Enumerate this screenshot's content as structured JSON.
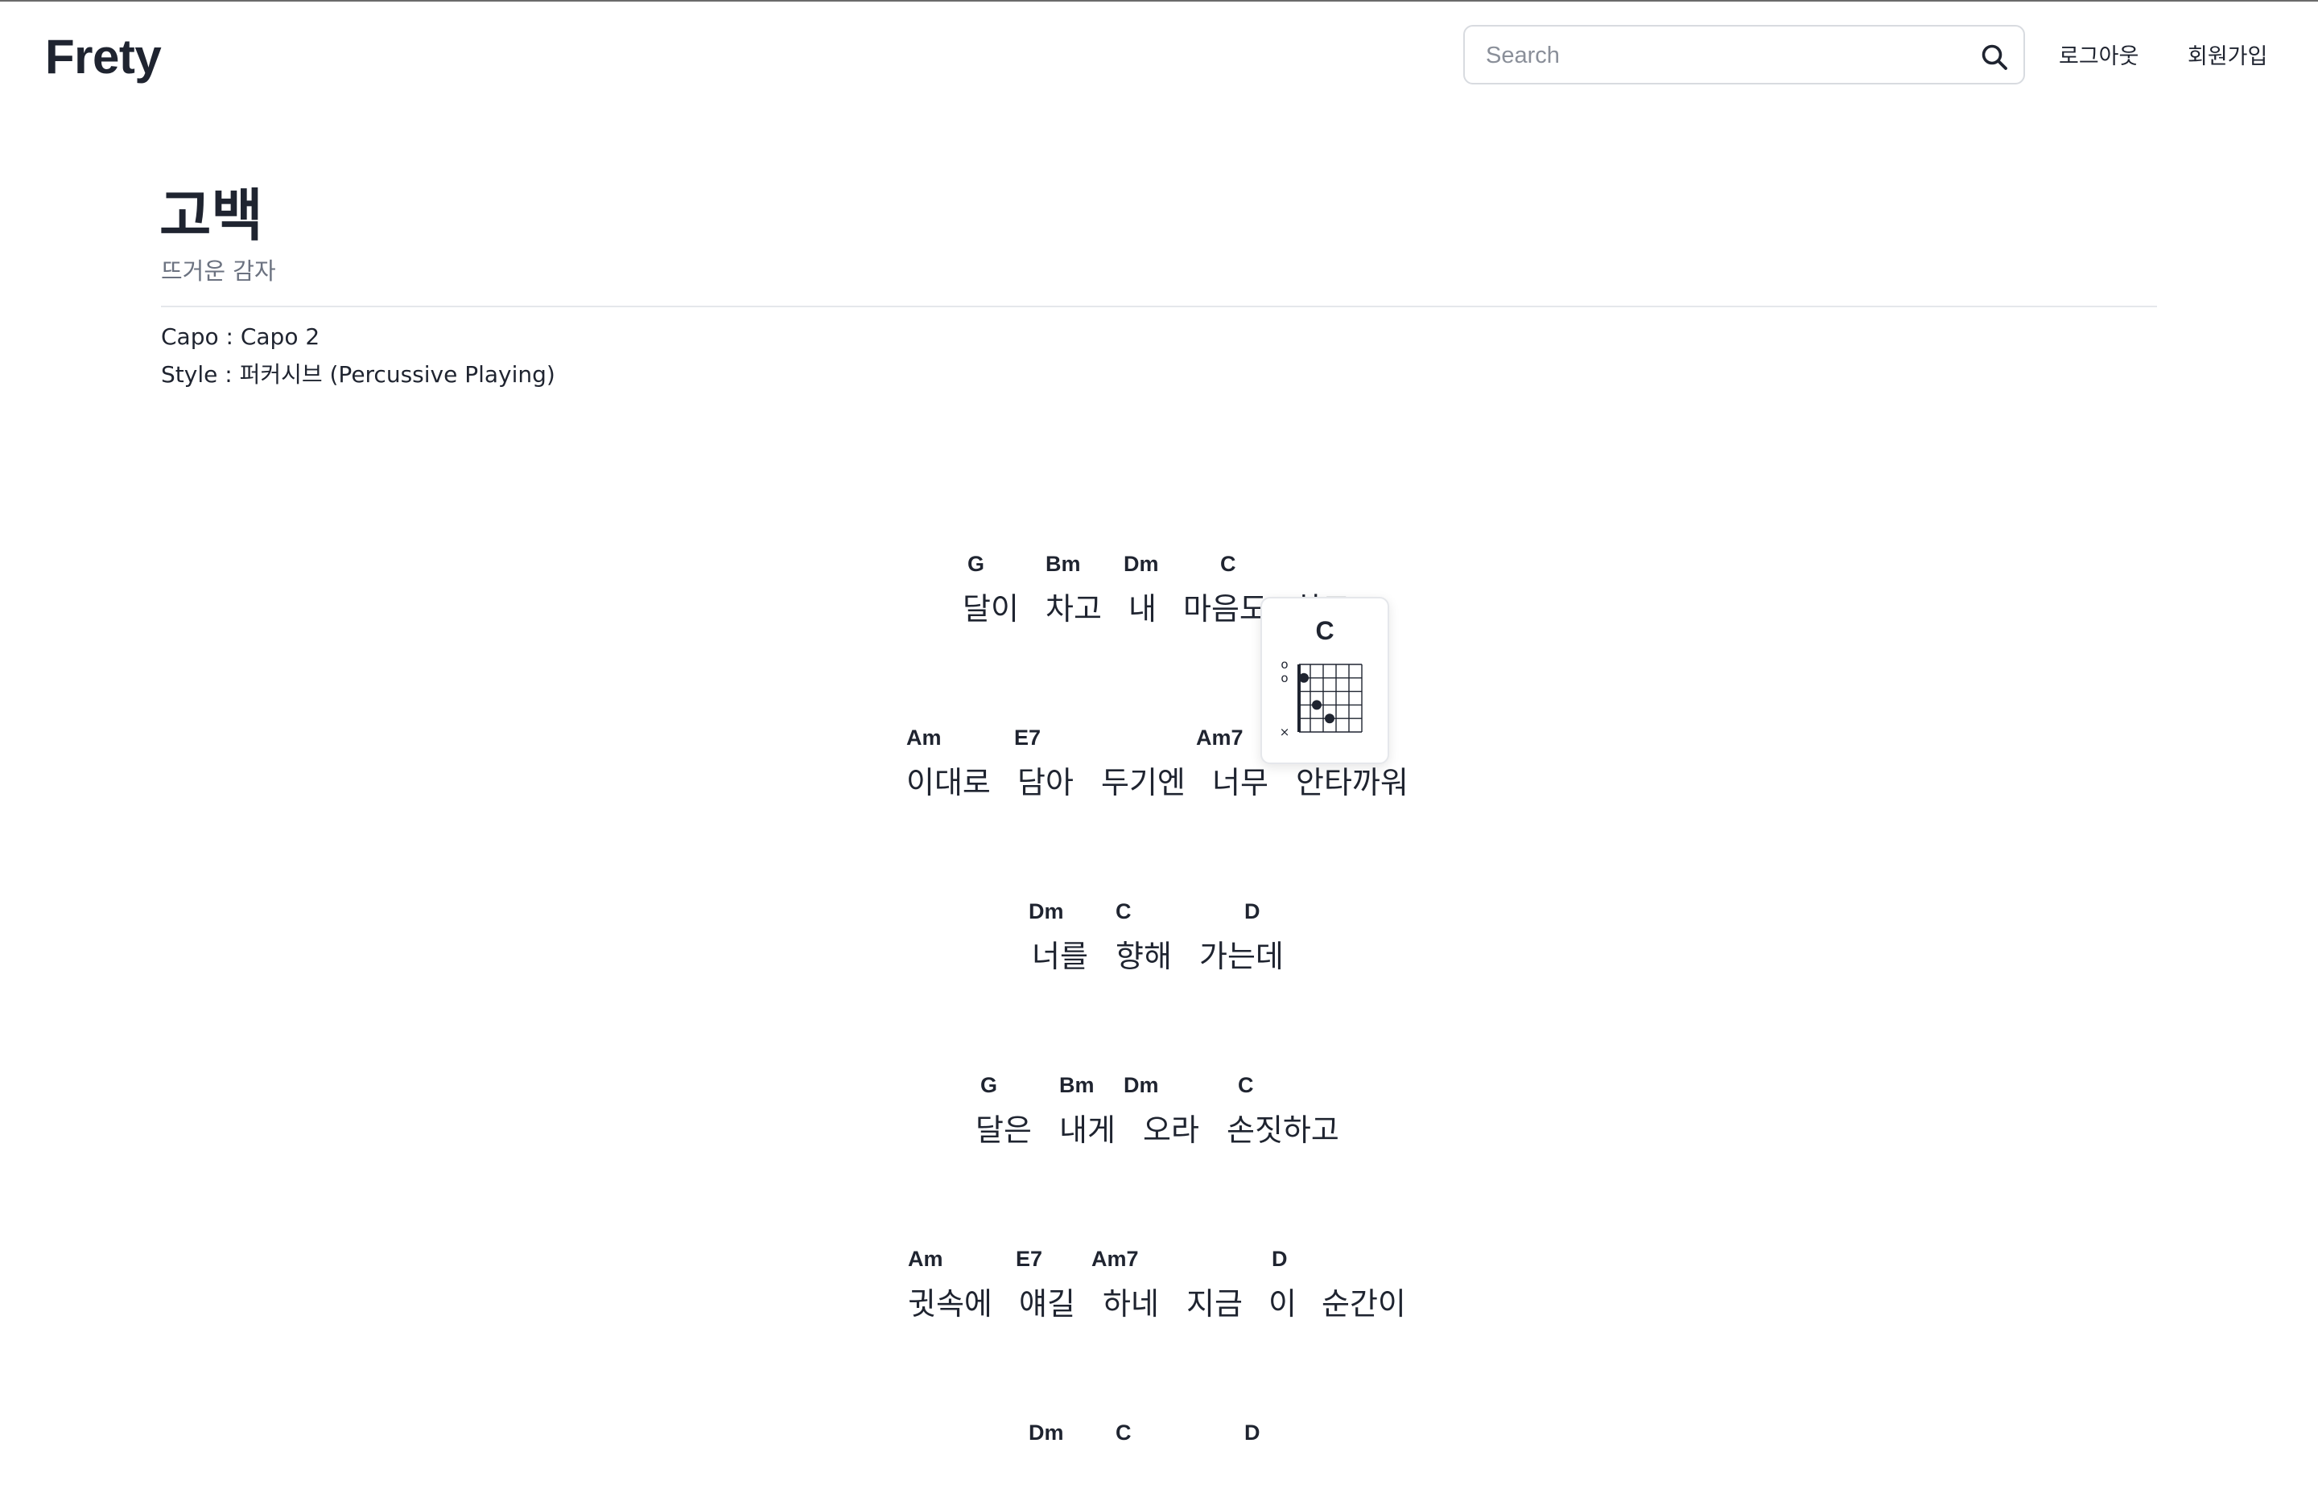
{
  "header": {
    "logo": "Frety",
    "search": {
      "placeholder": "Search",
      "value": ""
    },
    "nav": {
      "logout": "로그아웃",
      "signup": "회원가입"
    }
  },
  "song": {
    "title": "고백",
    "artist": "뜨거운 감자",
    "meta": {
      "capo_label": "Capo : Capo 2",
      "style_label": "Style : 퍼커시브 (Percussive Playing)"
    }
  },
  "lines": [
    {
      "segments": [
        {
          "chord": "G",
          "lyric": "달이"
        },
        {
          "chord": "Bm",
          "lyric": "차고"
        },
        {
          "chord": "Dm",
          "lyric": "내"
        },
        {
          "chord": "C",
          "lyric": "마음도"
        },
        {
          "chord": "",
          "lyric": "차고"
        }
      ]
    },
    {
      "segments": [
        {
          "chord": "Am",
          "lyric": "이대로"
        },
        {
          "chord": "E7",
          "lyric": "담아"
        },
        {
          "chord": "",
          "lyric": "두기엔"
        },
        {
          "chord": "Am7",
          "lyric": "너무"
        },
        {
          "chord": "",
          "lyric": "안타까워"
        }
      ]
    },
    {
      "segments": [
        {
          "chord": "Dm",
          "lyric": "너를"
        },
        {
          "chord": "C",
          "lyric": "향해"
        },
        {
          "chord": "D",
          "lyric": "가는데"
        }
      ]
    },
    {
      "segments": [
        {
          "chord": "G",
          "lyric": "달은"
        },
        {
          "chord": "Bm",
          "lyric": "내게"
        },
        {
          "chord": "Dm",
          "lyric": "오라"
        },
        {
          "chord": "C",
          "lyric": "손짓하고"
        }
      ]
    },
    {
      "segments": [
        {
          "chord": "Am",
          "lyric": "귓속에"
        },
        {
          "chord": "E7",
          "lyric": "얘길"
        },
        {
          "chord": "Am7",
          "lyric": "하네"
        },
        {
          "chord": "",
          "lyric": "지금"
        },
        {
          "chord": "D",
          "lyric": "이"
        },
        {
          "chord": "",
          "lyric": "순간이"
        }
      ]
    },
    {
      "segments": [
        {
          "chord": "Dm",
          "lyric": ""
        },
        {
          "chord": "C",
          "lyric": ""
        },
        {
          "chord": "D",
          "lyric": ""
        }
      ]
    }
  ],
  "chord_popover": {
    "name": "C",
    "string_markers": [
      "o",
      "o",
      "",
      "",
      "",
      "x"
    ],
    "fingers": [
      {
        "string": 2,
        "fret": 1
      },
      {
        "string": 4,
        "fret": 2
      },
      {
        "string": 5,
        "fret": 3
      }
    ]
  },
  "icons": {
    "search": "search-icon"
  }
}
